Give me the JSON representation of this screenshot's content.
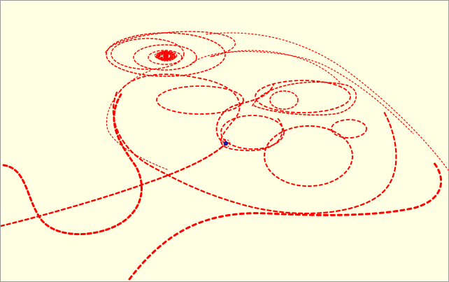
{
  "scene": {
    "background_color": "#ffffe3",
    "border_color": "#9a9a9a",
    "trail_color": "#ff0000",
    "marker_color": "#1a1a9a",
    "marker_icon": "player-marker-icon",
    "trail_style": "dotted-dashed"
  }
}
